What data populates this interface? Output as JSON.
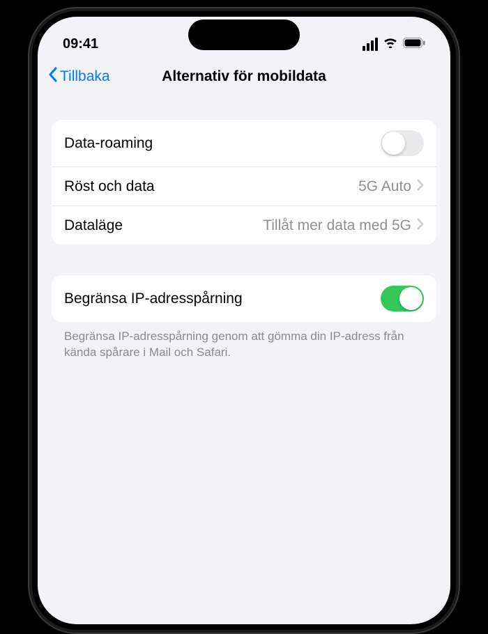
{
  "status": {
    "time": "09:41"
  },
  "nav": {
    "back": "Tillbaka",
    "title": "Alternativ för mobildata"
  },
  "group1": {
    "roaming": {
      "label": "Data-roaming",
      "enabled": false
    },
    "voice_data": {
      "label": "Röst och data",
      "value": "5G Auto"
    },
    "data_mode": {
      "label": "Dataläge",
      "value": "Tillåt mer data med 5G"
    }
  },
  "group2": {
    "limit_ip": {
      "label": "Begränsa IP-adresspårning",
      "enabled": true
    },
    "footer": "Begränsa IP-adresspårning genom att gömma din IP-adress från kända spårare i Mail och Safari."
  }
}
